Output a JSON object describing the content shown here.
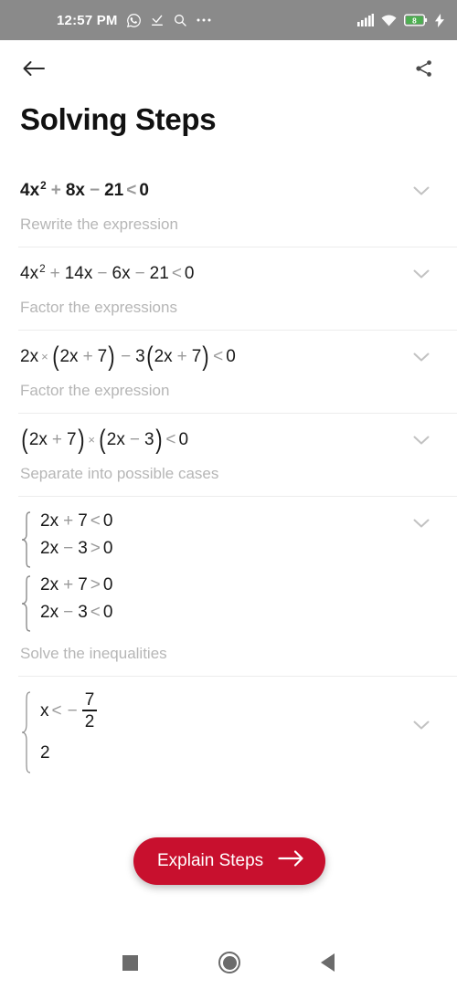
{
  "status_bar": {
    "time": "12:57 PM",
    "left_icons": [
      "whatsapp-icon",
      "download-complete-icon",
      "search-icon",
      "more-options-icon"
    ],
    "right_icons": [
      "signal-bars-icon",
      "wifi-icon",
      "battery-icon",
      "charging-bolt-icon"
    ],
    "battery_level": "8",
    "background_color": "#8a8a8a"
  },
  "app_bar": {
    "back_label": "back-arrow",
    "share_label": "share"
  },
  "header": {
    "title": "Solving Steps"
  },
  "accent_color": "#c8102e",
  "explain_button": {
    "label": "Explain Steps",
    "arrow": "arrow-right-icon"
  },
  "steps": [
    {
      "id": "step-1",
      "bold": true,
      "expression_text": "4x^2 + 8x - 21 < 0",
      "caption": "Rewrite the expression",
      "chevron": "chevron-down-icon"
    },
    {
      "id": "step-2",
      "bold": false,
      "expression_text": "4x^2 + 14x - 6x - 21 < 0",
      "caption": "Factor the expressions",
      "chevron": "chevron-down-icon"
    },
    {
      "id": "step-3",
      "bold": false,
      "expression_text": "2x × (2x + 7) - 3(2x + 7) < 0",
      "caption": "Factor the expression",
      "chevron": "chevron-down-icon"
    },
    {
      "id": "step-4",
      "bold": false,
      "expression_text": "(2x + 7) × (2x - 3) < 0",
      "caption": "Separate into possible cases",
      "chevron": "chevron-down-icon"
    },
    {
      "id": "step-5",
      "bold": false,
      "expression_text": "{ 2x + 7 < 0 ; 2x - 3 > 0 } { 2x + 7 > 0 ; 2x - 3 < 0 }",
      "caption": "Solve the inequalities",
      "chevron": "chevron-down-icon"
    },
    {
      "id": "step-6",
      "bold": false,
      "expression_text": "{ x < -7/2 ...",
      "caption": "",
      "chevron": "chevron-down-icon"
    }
  ],
  "tokens": {
    "four": "4",
    "x": "x",
    "two": "2",
    "three": "3",
    "six": "6",
    "seven": "7",
    "eight": "8",
    "fourteen": "14",
    "twentyone": "21",
    "zero": "0",
    "plus": "+",
    "minus": "−",
    "lt": "<",
    "gt": ">",
    "times": "×",
    "x2": "2x",
    "x3": "3",
    "lparen": "(",
    "rparen": ")"
  },
  "nav_bar": {
    "recents": "recents-square-icon",
    "home": "home-circle-icon",
    "back": "back-triangle-icon"
  }
}
